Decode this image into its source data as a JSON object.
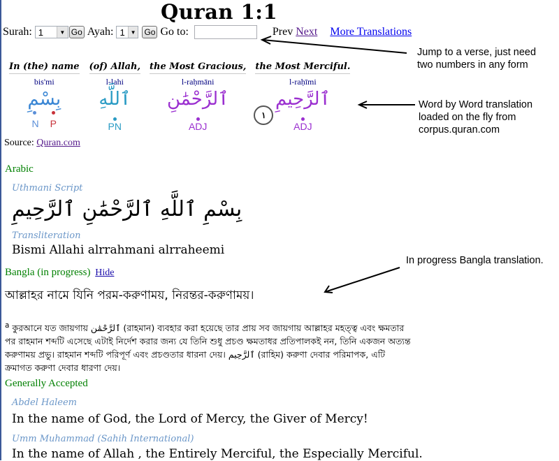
{
  "title": "Quran 1:1",
  "nav": {
    "surah_label": "Surah:",
    "surah_value": "1",
    "go_label": "Go",
    "ayah_label": "Ayah:",
    "ayah_value": "1",
    "goto_label": "Go to:",
    "goto_value": "",
    "prev_label": "Prev",
    "next_label": "Next",
    "more_label": "More Translations"
  },
  "annotations": {
    "jump": [
      "Jump to a verse, just need",
      "two numbers in any form"
    ],
    "wbw": [
      "Word by Word translation",
      "loaded on the fly from",
      "corpus.quran.com"
    ],
    "bangla": "In progress Bangla translation."
  },
  "word_by_word": [
    {
      "gloss": "In (the) name",
      "translit": "bis'mi",
      "arabic": "بِسْمِ",
      "color": "#3a86d4",
      "tags": [
        {
          "t": "N",
          "color": "#5b8fd8"
        },
        {
          "t": "P",
          "color": "#c8323a"
        }
      ]
    },
    {
      "gloss": "(of) Allah,",
      "translit": "l-lahi",
      "arabic": "ٱللَّهِ",
      "color": "#2a9bc4",
      "tags": [
        {
          "t": "PN",
          "color": "#2a9bc4"
        }
      ]
    },
    {
      "gloss": "the Most Gracious,",
      "translit": "l-raḥmāni",
      "arabic": "ٱلرَّحْمَٰنِ",
      "color": "#9b30d0",
      "tags": [
        {
          "t": "ADJ",
          "color": "#9b30d0"
        }
      ]
    },
    {
      "gloss": "the Most Merciful.",
      "translit": "l-raḥīmi",
      "arabic": "ٱلرَّحِيمِ",
      "color": "#9b30d0",
      "verse_mark": "١",
      "tags": [
        {
          "t": "ADJ",
          "color": "#9b30d0"
        }
      ]
    }
  ],
  "source": {
    "label": "Source:",
    "link": "Quran.com"
  },
  "arabic": {
    "heading": "Arabic",
    "uthmani_label": "Uthmani Script",
    "uthmani_text": "بِسْمِ ٱللَّهِ ٱلرَّحْمَٰنِ ٱلرَّحِيمِ",
    "translit_label": "Transliteration",
    "translit_text": "Bismi Allahi alrrahmani alrraheemi"
  },
  "bangla": {
    "heading": "Bangla (in progress)",
    "hide_label": "Hide",
    "text": "আল্লাহর নামে যিনি পরম-করুণাময়, নিরন্তর-করুণাময়।",
    "footnote_marker": "a",
    "footnote": "কুরআনে যত জায়গায় ٱلرَّحْمَٰن (রাহমান) ব্যবহার করা হয়েছে তার প্রায় সব জায়গায় আল্লাহর মহত্ত্ব এবং ক্ষমতার পর রাহমান শব্দটি এসেছে এটাই নির্দেশ করার জন্য যে তিনি শুধু প্রচণ্ড ক্ষমতাধর প্রতিপালকই নন, তিনি একজন অত্যন্ত করুণাময় প্রভু। রাহমান শব্দটি পরিপূর্ণ এবং প্রচণ্ডতার ধারনা দেয়। ٱلرَّحِيم (রাহিম) করুণা দেবার পরিমাপক, এটি ক্রমাগত করুণা দেবার ধারণা দেয়।"
  },
  "generally_accepted": {
    "heading": "Generally Accepted",
    "translations": [
      {
        "translator": "Abdel Haleem",
        "text": "In the name of God, the Lord of Mercy, the Giver of Mercy!"
      },
      {
        "translator": "Umm Muhammad (Sahih International)",
        "text": "In the name of Allah , the Entirely Merciful, the Especially Merciful."
      }
    ]
  }
}
